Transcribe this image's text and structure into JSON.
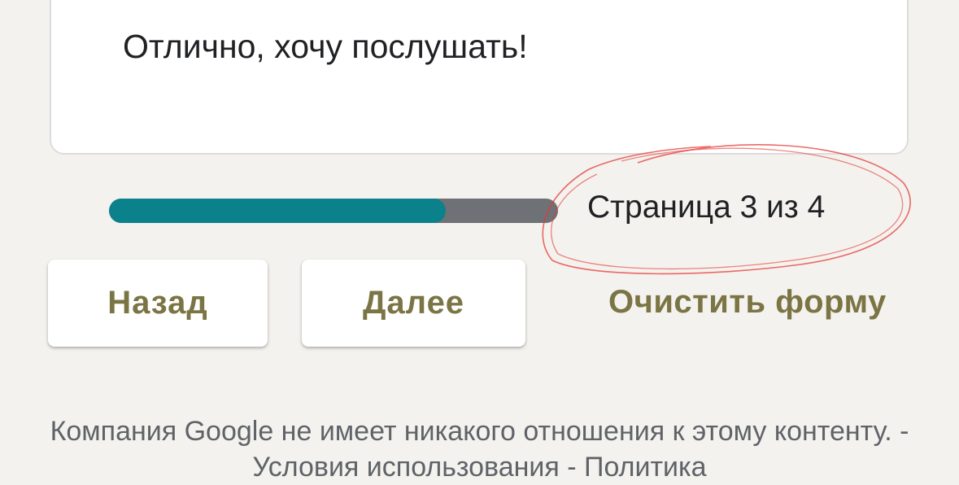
{
  "question": {
    "option_label": "Отлично, хочу послушать!"
  },
  "progress": {
    "fraction": 0.75,
    "page_label": "Страница 3 из 4",
    "fill_color": "#0b818c",
    "track_color": "#6e7175"
  },
  "navigation": {
    "back_label": "Назад",
    "next_label": "Далее",
    "clear_label": "Очистить форму"
  },
  "footer": {
    "disclaimer": "Компания Google не имеет никакого отношения к этому контенту.",
    "separator_1": "-",
    "terms_label": "Условия использования",
    "separator_2": "-",
    "privacy_label": "Политика"
  },
  "annotation": {
    "color": "#e53935"
  }
}
